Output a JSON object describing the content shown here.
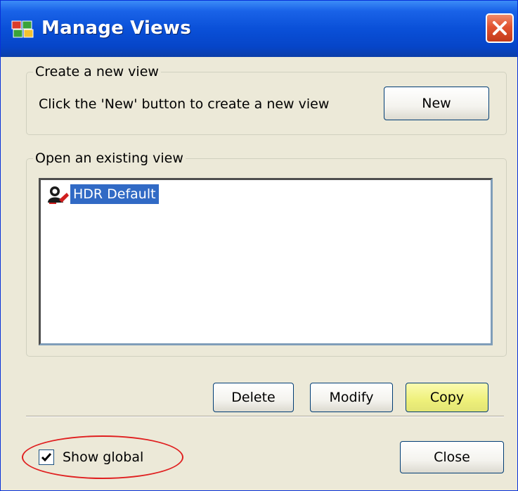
{
  "window": {
    "title": "Manage Views",
    "title_icon": "manage-views-icon",
    "close_icon": "close-icon"
  },
  "create_group": {
    "legend": "Create a new view",
    "instruction": "Click the 'New' button to create a new view",
    "new_button": "New"
  },
  "open_group": {
    "legend": "Open an existing view",
    "items": [
      {
        "label": "HDR Default",
        "icon": "view-user-icon",
        "selected": true
      }
    ]
  },
  "actions": {
    "delete": "Delete",
    "modify": "Modify",
    "copy": "Copy"
  },
  "footer": {
    "show_global_label": "Show global",
    "show_global_checked": true,
    "close_button": "Close"
  },
  "colors": {
    "titlebar": "#0a50d8",
    "dialog_bg": "#ece9d8",
    "selection": "#316ac5",
    "hot_button": "#eef07a",
    "annotation_ring": "#e02020"
  }
}
